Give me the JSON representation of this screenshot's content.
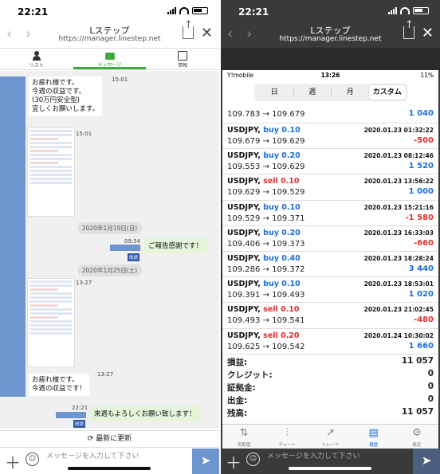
{
  "colors": {
    "accent_green": "#3daa3d",
    "line_blue": "#6f95cf",
    "buy_blue": "#1b6fd6",
    "sell_red": "#e03030",
    "my_bubble": "#e5f4da"
  },
  "left": {
    "status": {
      "time": "22:21"
    },
    "browser": {
      "title": "Lステップ",
      "url": "https://manager.linestep.net",
      "back_icon": "‹",
      "forward_icon": "›",
      "close_icon": "✕"
    },
    "tabs": [
      {
        "label": "リスト",
        "icon": "person-icon"
      },
      {
        "label": "メッセージ",
        "icon": "chat-icon"
      },
      {
        "label": "情報",
        "icon": "list-icon"
      }
    ],
    "chat": {
      "messages": [
        {
          "text_lines": [
            "お疲れ様です。",
            "今週の収益です。",
            "(30万円安全型)",
            "宜しくお願いします。"
          ],
          "time": "15:01"
        },
        {
          "time": "15:01"
        },
        {
          "date": "2020年1月19日(日)"
        },
        {
          "text": "ご報告感謝です！",
          "time": "09:54",
          "tag": "既読"
        },
        {
          "date": "2020年1月25日(土)"
        },
        {
          "time": "13:27"
        },
        {
          "text_lines": [
            "お疲れ様です。",
            "今週の収益です！"
          ],
          "time": "13:27"
        },
        {
          "text": "来週もよろしくお願い致します！",
          "time": "22:21",
          "tag": "既読"
        }
      ]
    },
    "refresh_label": "最新に更新",
    "composer": {
      "placeholder": "メッセージを入力して下さい",
      "plus": "＋",
      "smile": "☺",
      "send": "➤"
    }
  },
  "right": {
    "status": {
      "time": "22:21"
    },
    "browser": {
      "title": "Lステップ",
      "url": "https://manager.linestep.net"
    },
    "inner_status": {
      "carrier": "Y!mobile",
      "time": "13:26",
      "battery": "11%"
    },
    "segments": [
      "日",
      "週",
      "月",
      "カスタム"
    ],
    "top_row": {
      "price": "109.783 → 109.679",
      "pnl": "1 040"
    },
    "trades": [
      {
        "symbol": "USDJPY,",
        "dir": "buy 0.10",
        "time": "2020.01.23 01:32:22",
        "price": "109.679 → 109.629",
        "pnl": "-500",
        "side": "buy"
      },
      {
        "symbol": "USDJPY,",
        "dir": "buy 0.20",
        "time": "2020.01.23 08:12:46",
        "price": "109.553 → 109.629",
        "pnl": "1 520",
        "side": "buy"
      },
      {
        "symbol": "USDJPY,",
        "dir": "sell 0.10",
        "time": "2020.01.23 13:56:22",
        "price": "109.629 → 109.529",
        "pnl": "1 000",
        "side": "sell"
      },
      {
        "symbol": "USDJPY,",
        "dir": "buy 0.10",
        "time": "2020.01.23 15:21:16",
        "price": "109.529 → 109.371",
        "pnl": "-1 580",
        "side": "buy"
      },
      {
        "symbol": "USDJPY,",
        "dir": "buy 0.20",
        "time": "2020.01.23 16:33:03",
        "price": "109.406 → 109.373",
        "pnl": "-660",
        "side": "buy"
      },
      {
        "symbol": "USDJPY,",
        "dir": "buy 0.40",
        "time": "2020.01.23 18:28:24",
        "price": "109.286 → 109.372",
        "pnl": "3 440",
        "side": "buy"
      },
      {
        "symbol": "USDJPY,",
        "dir": "buy 0.10",
        "time": "2020.01.23 18:53:01",
        "price": "109.391 → 109.493",
        "pnl": "1 020",
        "side": "buy"
      },
      {
        "symbol": "USDJPY,",
        "dir": "sell 0.10",
        "time": "2020.01.23 21:02:45",
        "price": "109.493 → 109.541",
        "pnl": "-480",
        "side": "sell"
      },
      {
        "symbol": "USDJPY,",
        "dir": "sell 0.20",
        "time": "2020.01.24 10:30:02",
        "price": "109.625 → 109.542",
        "pnl": "1 660",
        "side": "sell"
      }
    ],
    "summary": [
      {
        "label": "損益:",
        "value": "11 057"
      },
      {
        "label": "クレジット:",
        "value": "0"
      },
      {
        "label": "証拠金:",
        "value": "0"
      },
      {
        "label": "出金:",
        "value": "0"
      },
      {
        "label": "残高:",
        "value": "11 057"
      }
    ],
    "bottom_nav": [
      {
        "label": "気配値",
        "icon": "quotes-icon"
      },
      {
        "label": "チャート",
        "icon": "chart-icon"
      },
      {
        "label": "トレード",
        "icon": "trade-icon"
      },
      {
        "label": "履歴",
        "icon": "history-icon"
      },
      {
        "label": "設定",
        "icon": "settings-icon"
      }
    ],
    "composer_placeholder": "メッセージを入力して下さい"
  }
}
